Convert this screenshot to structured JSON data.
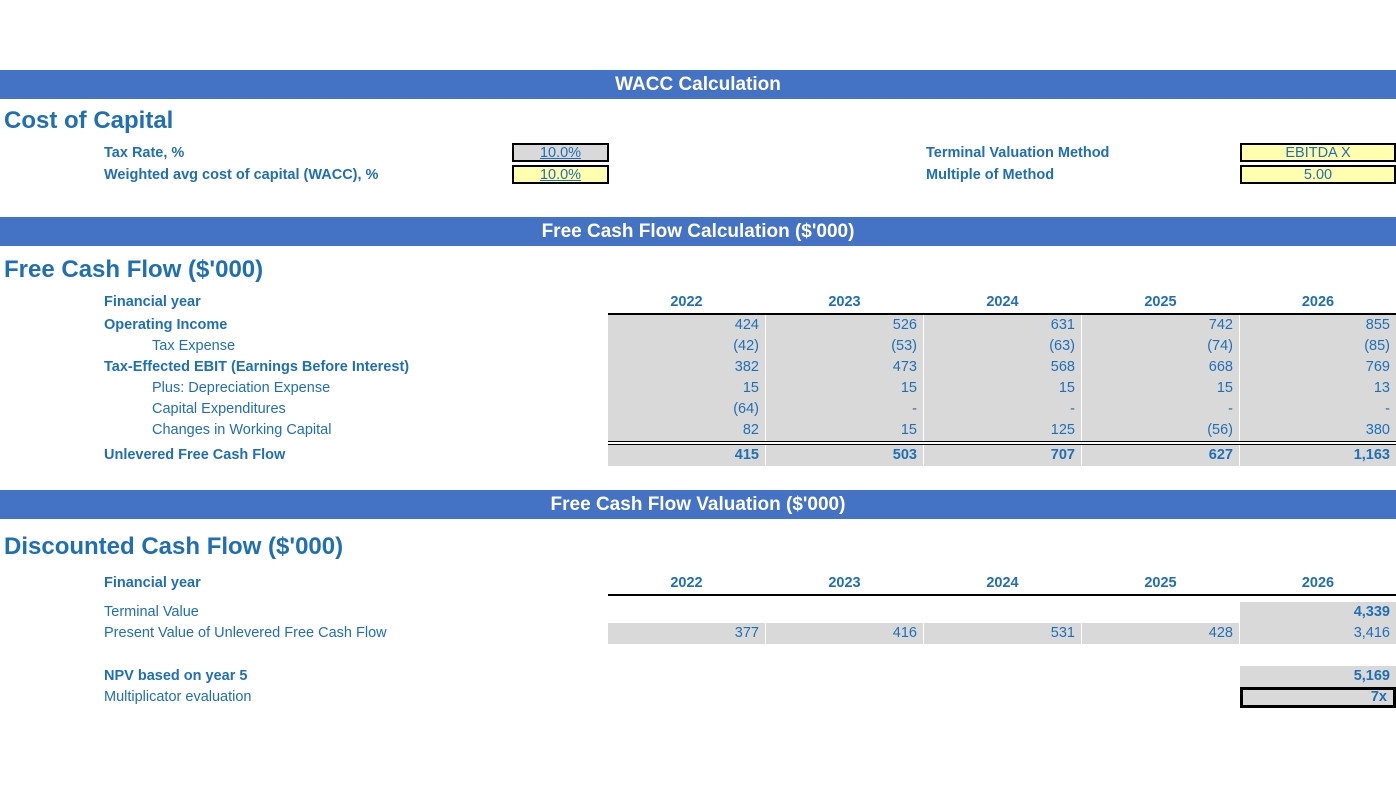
{
  "sections": {
    "wacc_bar": "WACC Calculation",
    "fcf_bar": "Free Cash Flow Calculation ($'000)",
    "valuation_bar": "Free Cash Flow Valuation ($'000)"
  },
  "cost_of_capital": {
    "title": "Cost of Capital",
    "left": [
      {
        "label": "Tax Rate, %",
        "value": "10.0%",
        "fill": "gray"
      },
      {
        "label": "Weighted avg cost of capital (WACC), %",
        "value": "10.0%",
        "fill": "yellow"
      }
    ],
    "right": [
      {
        "label": "Terminal Valuation Method",
        "value": "EBITDA X",
        "fill": "yellow"
      },
      {
        "label": "Multiple of Method",
        "value": "5.00",
        "fill": "yellow"
      }
    ]
  },
  "free_cash_flow": {
    "title": "Free Cash Flow ($'000)",
    "year_label": "Financial year",
    "years": [
      "2022",
      "2023",
      "2024",
      "2025",
      "2026"
    ],
    "rows": [
      {
        "label": "Operating Income",
        "style": "bold",
        "values": [
          "424",
          "526",
          "631",
          "742",
          "855"
        ]
      },
      {
        "label": "Tax Expense",
        "style": "indent",
        "values": [
          "(42)",
          "(53)",
          "(63)",
          "(74)",
          "(85)"
        ]
      },
      {
        "label": "Tax-Effected EBIT (Earnings Before Interest)",
        "style": "bold",
        "values": [
          "382",
          "473",
          "568",
          "668",
          "769"
        ]
      },
      {
        "label": "Plus: Depreciation Expense",
        "style": "indent",
        "values": [
          "15",
          "15",
          "15",
          "15",
          "13"
        ]
      },
      {
        "label": "Capital Expenditures",
        "style": "indent",
        "values": [
          "(64)",
          "-",
          "-",
          "-",
          "-"
        ]
      },
      {
        "label": "Changes in Working Capital",
        "style": "indent",
        "values": [
          "82",
          "15",
          "125",
          "(56)",
          "380"
        ]
      }
    ],
    "total": {
      "label": "Unlevered Free Cash Flow",
      "values": [
        "415",
        "503",
        "707",
        "627",
        "1,163"
      ]
    }
  },
  "discounted_cash_flow": {
    "title": "Discounted Cash Flow ($'000)",
    "year_label": "Financial year",
    "years": [
      "2022",
      "2023",
      "2024",
      "2025",
      "2026"
    ],
    "rows": [
      {
        "label": "Terminal Value",
        "style": "plain",
        "bold_values": true,
        "values": [
          "",
          "",
          "",
          "",
          "4,339"
        ]
      },
      {
        "label": "Present Value of Unlevered Free Cash Flow",
        "style": "plain",
        "bold_values": false,
        "values": [
          "377",
          "416",
          "531",
          "428",
          "3,416"
        ]
      }
    ],
    "npv": {
      "label": "NPV based on year 5",
      "values": [
        "",
        "",
        "",
        "",
        "5,169"
      ]
    },
    "multiplicator": {
      "label": "Multiplicator evaluation",
      "values": [
        "",
        "",
        "",
        "",
        "7x"
      ]
    }
  },
  "colors": {
    "bar_blue": "#4472C4",
    "text_blue": "#1F6FB5",
    "cell_gray": "#D9D9D9",
    "input_yellow": "#FFFFAF"
  }
}
